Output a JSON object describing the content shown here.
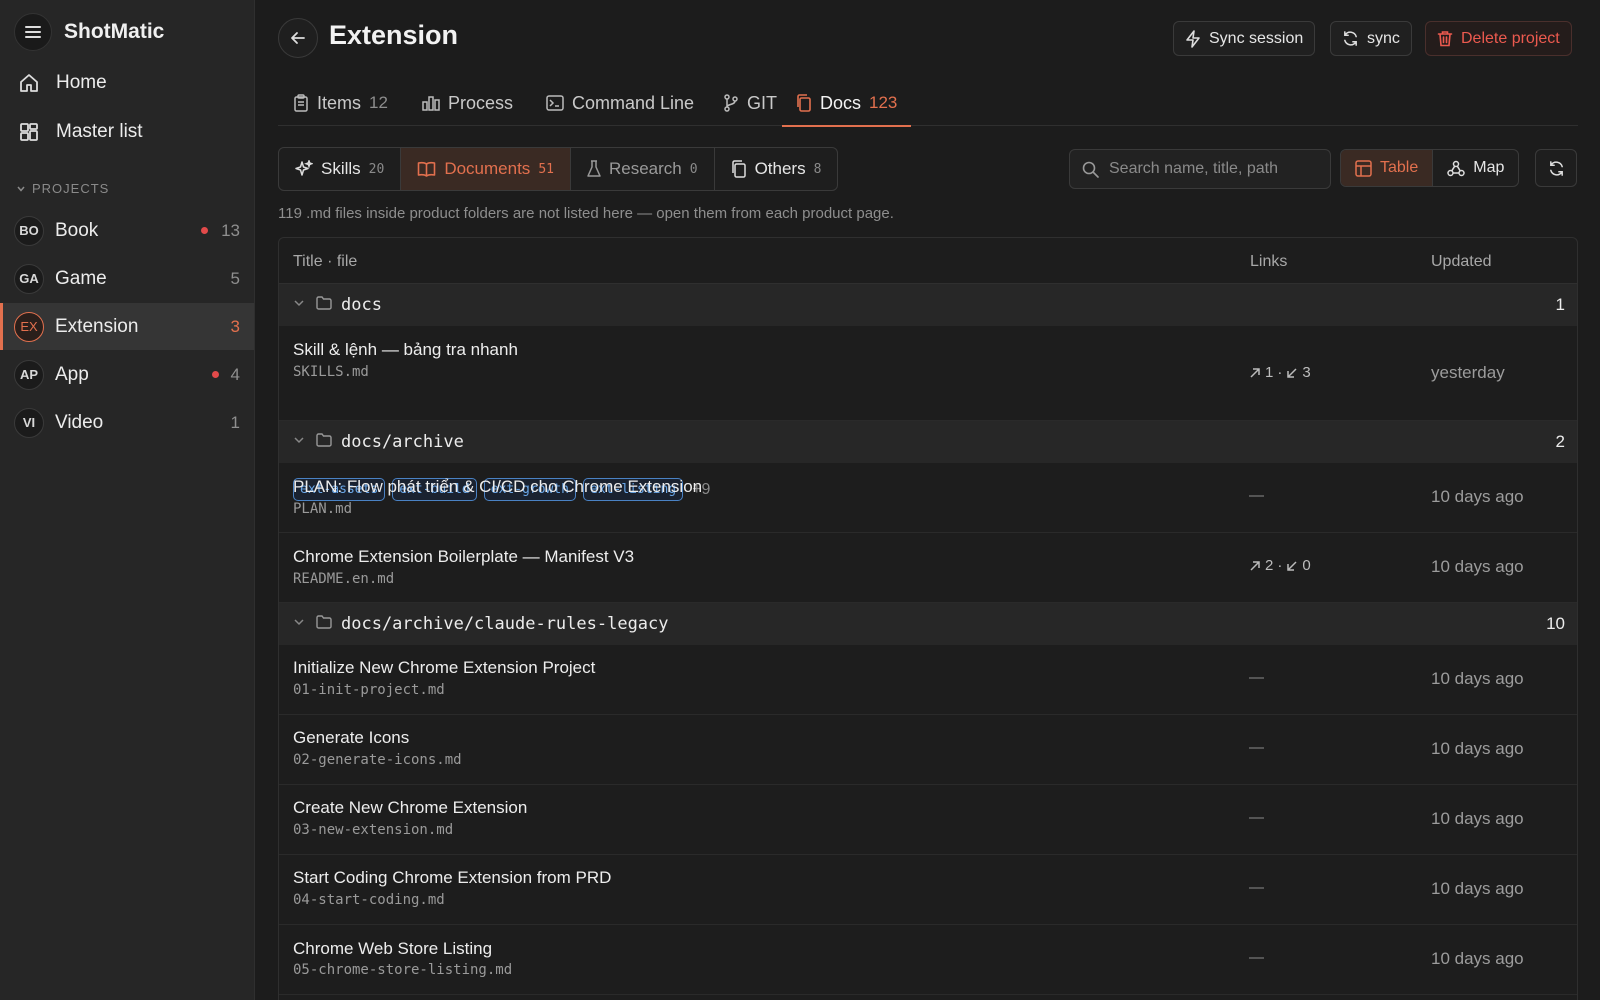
{
  "app": {
    "brand": "ShotMatic"
  },
  "sidebar": {
    "nav": [
      {
        "label": "Home",
        "icon": "home-icon"
      },
      {
        "label": "Master list",
        "icon": "grid-icon"
      }
    ],
    "section_label": "PROJECTS",
    "projects": [
      {
        "badge": "BO",
        "name": "Book",
        "count": "13",
        "dot": true,
        "active": false
      },
      {
        "badge": "GA",
        "name": "Game",
        "count": "5",
        "dot": false,
        "active": false
      },
      {
        "badge": "EX",
        "name": "Extension",
        "count": "3",
        "dot": false,
        "active": true
      },
      {
        "badge": "AP",
        "name": "App",
        "count": "4",
        "dot": true,
        "active": false
      },
      {
        "badge": "VI",
        "name": "Video",
        "count": "1",
        "dot": false,
        "active": false
      }
    ]
  },
  "header": {
    "title": "Extension",
    "sync_session_label": "Sync session",
    "sync_label": "sync",
    "delete_label": "Delete project"
  },
  "tabs": [
    {
      "label": "Items",
      "count": "12"
    },
    {
      "label": "Process",
      "count": ""
    },
    {
      "label": "Command Line",
      "count": ""
    },
    {
      "label": "GIT",
      "count": ""
    },
    {
      "label": "Docs",
      "count": "123",
      "active": true
    }
  ],
  "filters": [
    {
      "label": "Skills",
      "count": "20"
    },
    {
      "label": "Documents",
      "count": "51",
      "active": true
    },
    {
      "label": "Research",
      "count": "0"
    },
    {
      "label": "Others",
      "count": "8"
    }
  ],
  "search": {
    "placeholder": "Search name, title, path"
  },
  "view": {
    "table_label": "Table",
    "map_label": "Map"
  },
  "notice": "119 .md files inside product folders are not listed here — open them from each product page.",
  "table": {
    "columns": {
      "title": "Title · file",
      "links": "Links",
      "updated": "Updated"
    },
    "groups": [
      {
        "name": "docs",
        "count": "1"
      },
      {
        "name": "docs/archive",
        "count": "2"
      },
      {
        "name": "docs/archive/claude-rules-legacy",
        "count": "10"
      }
    ],
    "rows": [
      {
        "title": "Skill & lệnh — bảng tra nhanh",
        "file": "SKILLS.md",
        "links_out": "1",
        "links_in": "3",
        "updated": "yesterday",
        "tags": [
          "ext-assets",
          "ext-build",
          "ext-growth",
          "ext-listing"
        ],
        "more_tags": "+9"
      },
      {
        "title": "PLAN: Flow phát triển & CI/CD cho Chrome Extension",
        "file": "PLAN.md",
        "links": "—",
        "updated": "10 days ago"
      },
      {
        "title": "Chrome Extension Boilerplate — Manifest V3",
        "file": "README.en.md",
        "links_out": "2",
        "links_in": "0",
        "updated": "10 days ago"
      },
      {
        "title": "Initialize New Chrome Extension Project",
        "file": "01-init-project.md",
        "links": "—",
        "updated": "10 days ago"
      },
      {
        "title": "Generate Icons",
        "file": "02-generate-icons.md",
        "links": "—",
        "updated": "10 days ago"
      },
      {
        "title": "Create New Chrome Extension",
        "file": "03-new-extension.md",
        "links": "—",
        "updated": "10 days ago"
      },
      {
        "title": "Start Coding Chrome Extension from PRD",
        "file": "04-start-coding.md",
        "links": "—",
        "updated": "10 days ago"
      },
      {
        "title": "Chrome Web Store Listing",
        "file": "05-chrome-store-listing.md",
        "links": "—",
        "updated": "10 days ago"
      }
    ]
  },
  "colors": {
    "accent": "#e2704e",
    "danger": "#ec5a4f",
    "tag": "#6aa7e8",
    "background": "#1c1c1c",
    "sidebar": "#262626"
  }
}
